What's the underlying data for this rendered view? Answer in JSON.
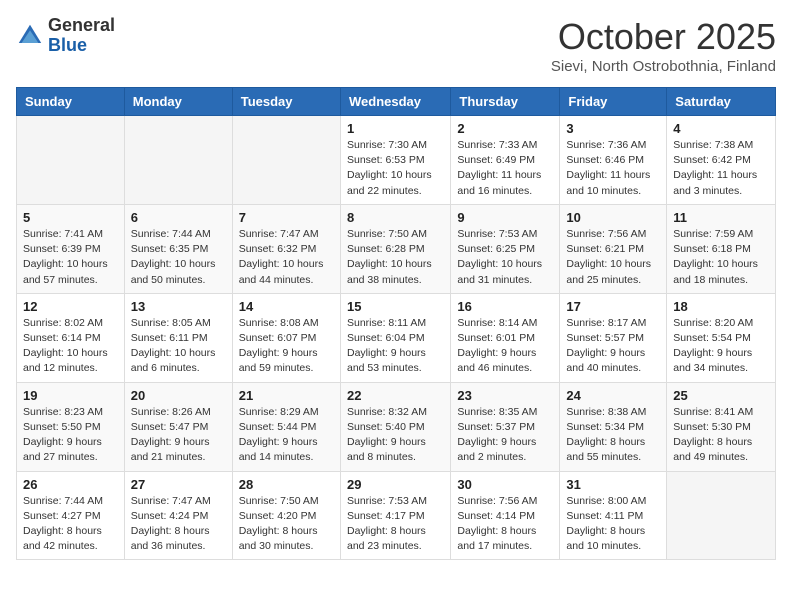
{
  "header": {
    "logo_general": "General",
    "logo_blue": "Blue",
    "month": "October 2025",
    "location": "Sievi, North Ostrobothnia, Finland"
  },
  "weekdays": [
    "Sunday",
    "Monday",
    "Tuesday",
    "Wednesday",
    "Thursday",
    "Friday",
    "Saturday"
  ],
  "weeks": [
    [
      {
        "day": "",
        "sunrise": "",
        "sunset": "",
        "daylight": ""
      },
      {
        "day": "",
        "sunrise": "",
        "sunset": "",
        "daylight": ""
      },
      {
        "day": "",
        "sunrise": "",
        "sunset": "",
        "daylight": ""
      },
      {
        "day": "1",
        "sunrise": "Sunrise: 7:30 AM",
        "sunset": "Sunset: 6:53 PM",
        "daylight": "Daylight: 10 hours and 22 minutes."
      },
      {
        "day": "2",
        "sunrise": "Sunrise: 7:33 AM",
        "sunset": "Sunset: 6:49 PM",
        "daylight": "Daylight: 11 hours and 16 minutes."
      },
      {
        "day": "3",
        "sunrise": "Sunrise: 7:36 AM",
        "sunset": "Sunset: 6:46 PM",
        "daylight": "Daylight: 11 hours and 10 minutes."
      },
      {
        "day": "4",
        "sunrise": "Sunrise: 7:38 AM",
        "sunset": "Sunset: 6:42 PM",
        "daylight": "Daylight: 11 hours and 3 minutes."
      }
    ],
    [
      {
        "day": "5",
        "sunrise": "Sunrise: 7:41 AM",
        "sunset": "Sunset: 6:39 PM",
        "daylight": "Daylight: 10 hours and 57 minutes."
      },
      {
        "day": "6",
        "sunrise": "Sunrise: 7:44 AM",
        "sunset": "Sunset: 6:35 PM",
        "daylight": "Daylight: 10 hours and 50 minutes."
      },
      {
        "day": "7",
        "sunrise": "Sunrise: 7:47 AM",
        "sunset": "Sunset: 6:32 PM",
        "daylight": "Daylight: 10 hours and 44 minutes."
      },
      {
        "day": "8",
        "sunrise": "Sunrise: 7:50 AM",
        "sunset": "Sunset: 6:28 PM",
        "daylight": "Daylight: 10 hours and 38 minutes."
      },
      {
        "day": "9",
        "sunrise": "Sunrise: 7:53 AM",
        "sunset": "Sunset: 6:25 PM",
        "daylight": "Daylight: 10 hours and 31 minutes."
      },
      {
        "day": "10",
        "sunrise": "Sunrise: 7:56 AM",
        "sunset": "Sunset: 6:21 PM",
        "daylight": "Daylight: 10 hours and 25 minutes."
      },
      {
        "day": "11",
        "sunrise": "Sunrise: 7:59 AM",
        "sunset": "Sunset: 6:18 PM",
        "daylight": "Daylight: 10 hours and 18 minutes."
      }
    ],
    [
      {
        "day": "12",
        "sunrise": "Sunrise: 8:02 AM",
        "sunset": "Sunset: 6:14 PM",
        "daylight": "Daylight: 10 hours and 12 minutes."
      },
      {
        "day": "13",
        "sunrise": "Sunrise: 8:05 AM",
        "sunset": "Sunset: 6:11 PM",
        "daylight": "Daylight: 10 hours and 6 minutes."
      },
      {
        "day": "14",
        "sunrise": "Sunrise: 8:08 AM",
        "sunset": "Sunset: 6:07 PM",
        "daylight": "Daylight: 9 hours and 59 minutes."
      },
      {
        "day": "15",
        "sunrise": "Sunrise: 8:11 AM",
        "sunset": "Sunset: 6:04 PM",
        "daylight": "Daylight: 9 hours and 53 minutes."
      },
      {
        "day": "16",
        "sunrise": "Sunrise: 8:14 AM",
        "sunset": "Sunset: 6:01 PM",
        "daylight": "Daylight: 9 hours and 46 minutes."
      },
      {
        "day": "17",
        "sunrise": "Sunrise: 8:17 AM",
        "sunset": "Sunset: 5:57 PM",
        "daylight": "Daylight: 9 hours and 40 minutes."
      },
      {
        "day": "18",
        "sunrise": "Sunrise: 8:20 AM",
        "sunset": "Sunset: 5:54 PM",
        "daylight": "Daylight: 9 hours and 34 minutes."
      }
    ],
    [
      {
        "day": "19",
        "sunrise": "Sunrise: 8:23 AM",
        "sunset": "Sunset: 5:50 PM",
        "daylight": "Daylight: 9 hours and 27 minutes."
      },
      {
        "day": "20",
        "sunrise": "Sunrise: 8:26 AM",
        "sunset": "Sunset: 5:47 PM",
        "daylight": "Daylight: 9 hours and 21 minutes."
      },
      {
        "day": "21",
        "sunrise": "Sunrise: 8:29 AM",
        "sunset": "Sunset: 5:44 PM",
        "daylight": "Daylight: 9 hours and 14 minutes."
      },
      {
        "day": "22",
        "sunrise": "Sunrise: 8:32 AM",
        "sunset": "Sunset: 5:40 PM",
        "daylight": "Daylight: 9 hours and 8 minutes."
      },
      {
        "day": "23",
        "sunrise": "Sunrise: 8:35 AM",
        "sunset": "Sunset: 5:37 PM",
        "daylight": "Daylight: 9 hours and 2 minutes."
      },
      {
        "day": "24",
        "sunrise": "Sunrise: 8:38 AM",
        "sunset": "Sunset: 5:34 PM",
        "daylight": "Daylight: 8 hours and 55 minutes."
      },
      {
        "day": "25",
        "sunrise": "Sunrise: 8:41 AM",
        "sunset": "Sunset: 5:30 PM",
        "daylight": "Daylight: 8 hours and 49 minutes."
      }
    ],
    [
      {
        "day": "26",
        "sunrise": "Sunrise: 7:44 AM",
        "sunset": "Sunset: 4:27 PM",
        "daylight": "Daylight: 8 hours and 42 minutes."
      },
      {
        "day": "27",
        "sunrise": "Sunrise: 7:47 AM",
        "sunset": "Sunset: 4:24 PM",
        "daylight": "Daylight: 8 hours and 36 minutes."
      },
      {
        "day": "28",
        "sunrise": "Sunrise: 7:50 AM",
        "sunset": "Sunset: 4:20 PM",
        "daylight": "Daylight: 8 hours and 30 minutes."
      },
      {
        "day": "29",
        "sunrise": "Sunrise: 7:53 AM",
        "sunset": "Sunset: 4:17 PM",
        "daylight": "Daylight: 8 hours and 23 minutes."
      },
      {
        "day": "30",
        "sunrise": "Sunrise: 7:56 AM",
        "sunset": "Sunset: 4:14 PM",
        "daylight": "Daylight: 8 hours and 17 minutes."
      },
      {
        "day": "31",
        "sunrise": "Sunrise: 8:00 AM",
        "sunset": "Sunset: 4:11 PM",
        "daylight": "Daylight: 8 hours and 10 minutes."
      },
      {
        "day": "",
        "sunrise": "",
        "sunset": "",
        "daylight": ""
      }
    ]
  ]
}
